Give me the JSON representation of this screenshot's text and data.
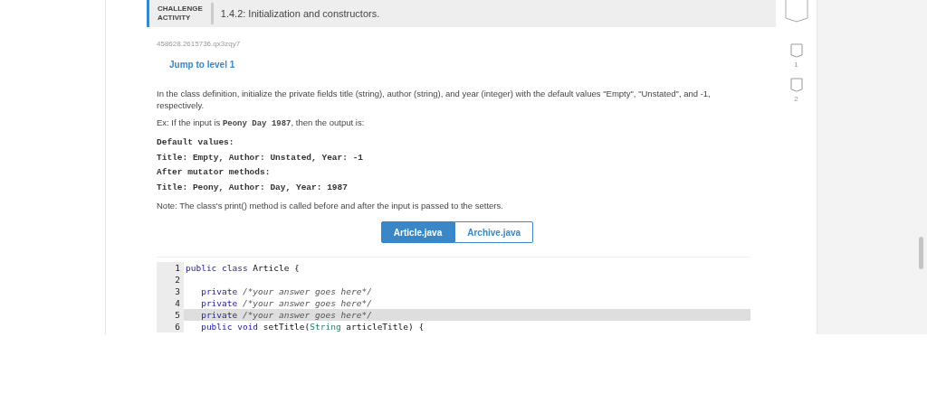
{
  "header": {
    "badge_lines": [
      "CHALLENGE",
      "ACTIVITY"
    ],
    "title": "1.4.2: Initialization and constructors."
  },
  "activity_id": "458628.2615736.qx3zqy7",
  "jump_link": "Jump to level 1",
  "levels": [
    {
      "label": "1",
      "done": false
    },
    {
      "label": "2",
      "done": false
    }
  ],
  "paragraphs": [
    "In the class definition, initialize the private fields title (string), author (string), and year (integer) with the default values \"Empty\", \"Unstated\", and -1, respectively."
  ],
  "example": {
    "before": "Ex: If the input is ",
    "input": "Peony Day 1987",
    "after": ", then the output is:"
  },
  "output_lines": [
    "Default values:",
    "Title: Empty, Author: Unstated, Year: -1",
    "After mutator methods:",
    "Title: Peony, Author: Day, Year: 1987"
  ],
  "note": "Note: The class's print() method is called before and after the input is passed to the setters.",
  "file_tabs": [
    {
      "label": "Article.java",
      "selected": true
    },
    {
      "label": "Archive.java",
      "selected": false
    }
  ],
  "code_lines": [
    {
      "number": "1",
      "tokens": [
        {
          "kind": "keyword",
          "text": "public class"
        },
        {
          "kind": "plain",
          "text": " Article {"
        }
      ],
      "highlighted": false
    },
    {
      "number": "2",
      "highlighted": false
    },
    {
      "number": "3",
      "tokens": [
        {
          "kind": "keyword",
          "text": "   private"
        },
        {
          "kind": "comment",
          "text": " /*your answer goes here*/"
        }
      ],
      "highlighted": false
    },
    {
      "number": "4",
      "tokens": [
        {
          "kind": "keyword",
          "text": "   private"
        },
        {
          "kind": "comment",
          "text": " /*your answer goes here*/"
        }
      ],
      "highlighted": false
    },
    {
      "number": "5",
      "tokens": [
        {
          "kind": "keyword",
          "text": "   private"
        },
        {
          "kind": "comment",
          "text": " /*your answer goes here*/"
        }
      ],
      "highlighted": true
    },
    {
      "number": "6",
      "tokens": [
        {
          "kind": "keyword",
          "text": "   public void"
        },
        {
          "kind": "plain",
          "text": " setTitle("
        },
        {
          "kind": "type",
          "text": "String"
        },
        {
          "kind": "plain",
          "text": " articleTitle) {"
        }
      ],
      "highlighted": false
    }
  ]
}
